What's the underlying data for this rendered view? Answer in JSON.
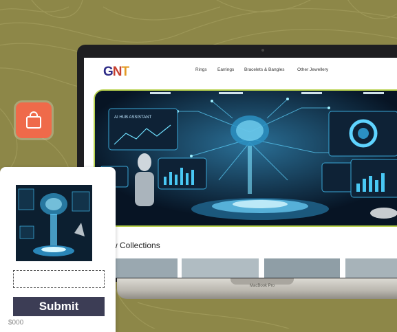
{
  "site": {
    "logo_parts": [
      "G",
      "N",
      "T"
    ],
    "nav": [
      "Rings",
      "Earrings",
      "Bracelets & Bangles",
      "Other Jewellery"
    ],
    "section_title": "New Collections",
    "section_title_visible": "w Collections"
  },
  "laptop": {
    "model_label": "MacBook Pro"
  },
  "hero": {
    "panel_title": "AI HUB ASSISTANT",
    "image_subject": "futuristic AI brain holographic dashboard"
  },
  "card": {
    "submit_label": "Submit",
    "price_fragment": "$000"
  },
  "icons": {
    "bag": "shopping-bag-icon"
  },
  "colors": {
    "background": "#8d8748",
    "bag_button": "#ef6a4a",
    "submit_button": "#3c3d55",
    "hero_border": "#b8d14c"
  }
}
